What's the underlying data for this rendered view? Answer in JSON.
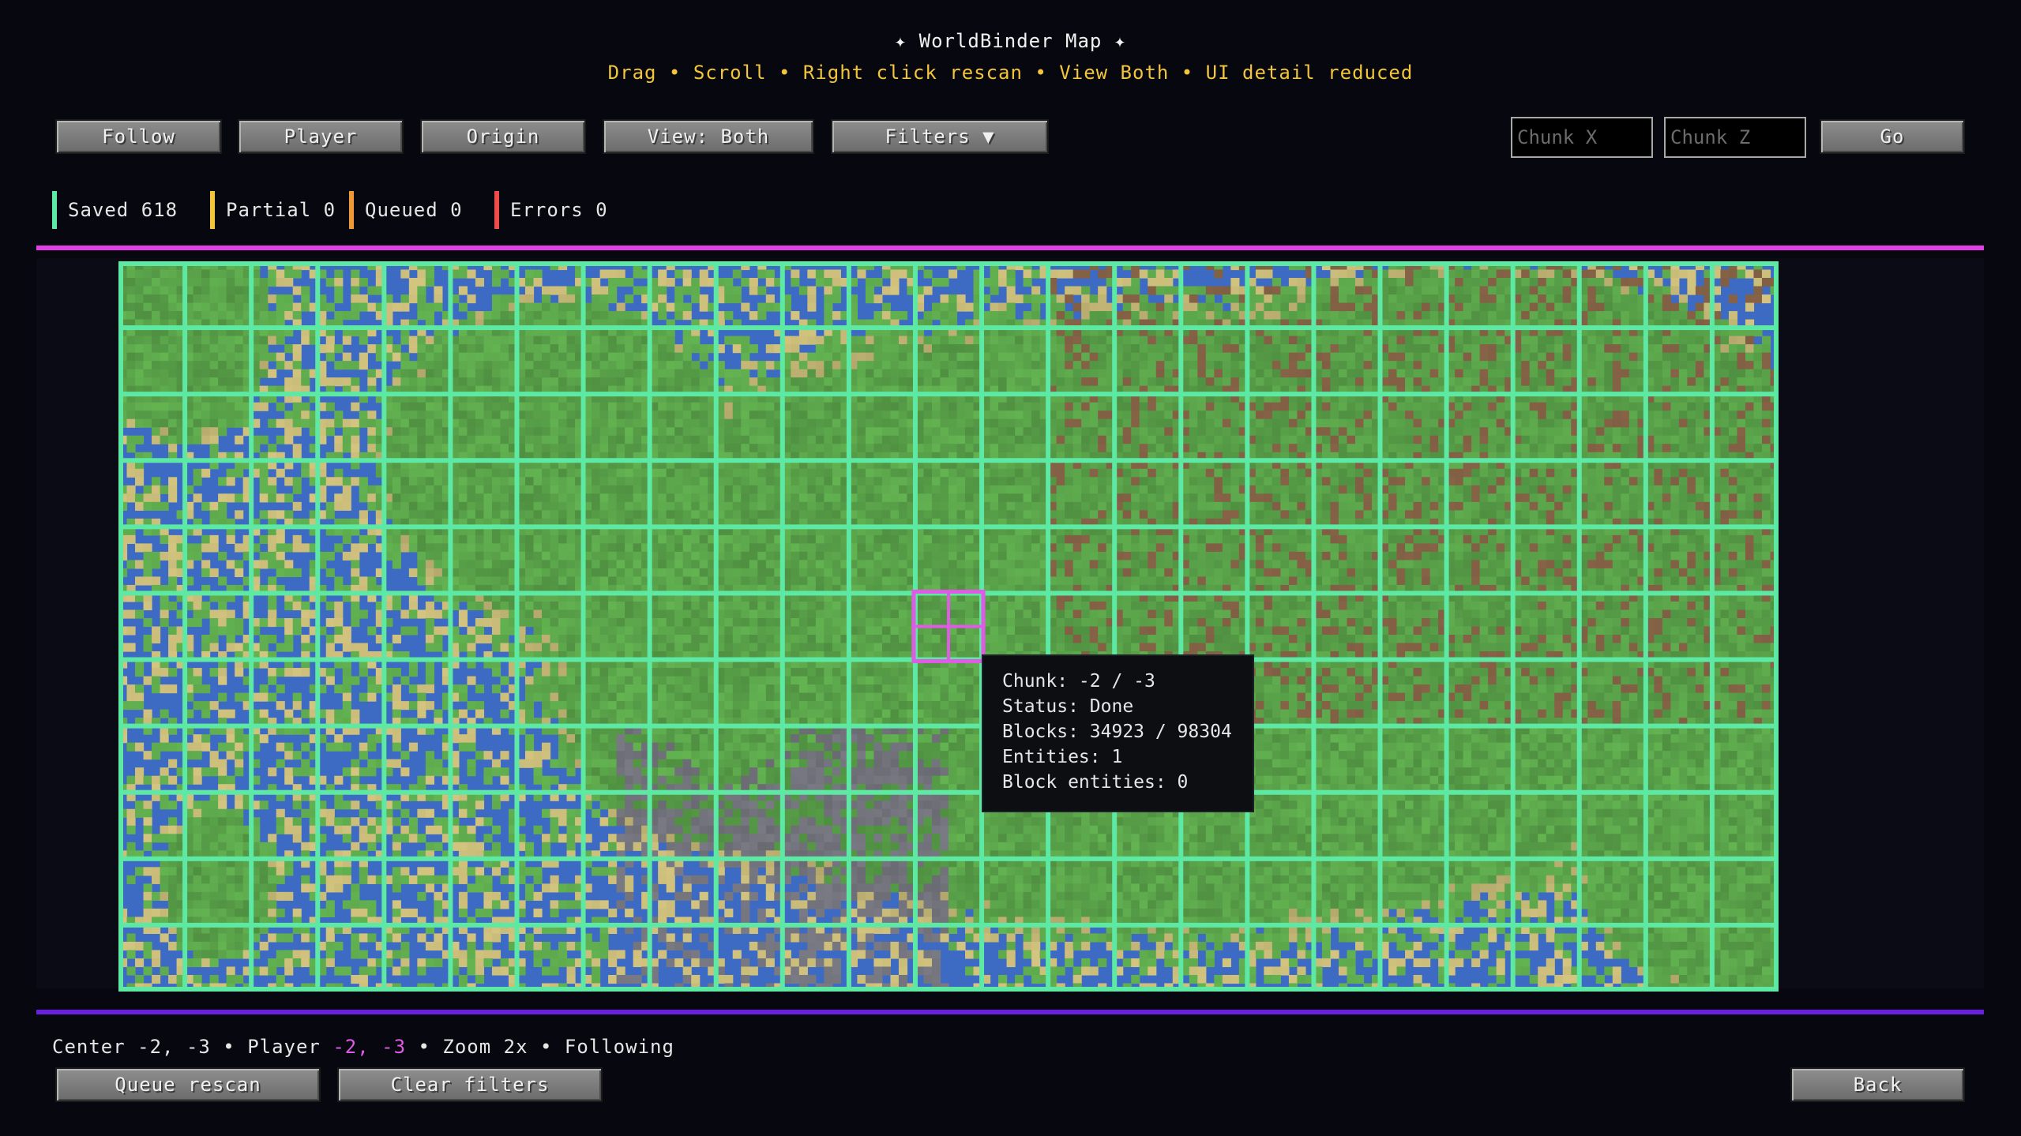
{
  "window": {
    "title": "✦ WorldBinder Map ✦",
    "subtitle": "Drag • Scroll • Right click rescan • View Both • UI detail reduced"
  },
  "toolbar": {
    "follow": "Follow",
    "player": "Player",
    "origin": "Origin",
    "view": "View: Both",
    "filters": "Filters ▼",
    "chunk_x_placeholder": "Chunk X",
    "chunk_z_placeholder": "Chunk Z",
    "go": "Go"
  },
  "legend": [
    {
      "label": "Saved 618",
      "color": "#5de8a4"
    },
    {
      "label": "Partial 0",
      "color": "#f3c53a"
    },
    {
      "label": "Queued 0",
      "color": "#f0973a"
    },
    {
      "label": "Errors 0",
      "color": "#f04a4a"
    }
  ],
  "colors": {
    "top_divider": "#e33ee8",
    "bottom_divider": "#6a1fe0",
    "grid_line": "#5de8a4",
    "selected_chunk": "#e05ae6",
    "water": "#3d6bc4",
    "grass": "#5aa34a",
    "stone": "#6f6f78",
    "sand": "#cbbd7a",
    "dirt": "#7a5a40"
  },
  "map": {
    "columns": 25,
    "rows": 11,
    "selected": {
      "col": 12,
      "row": 5
    }
  },
  "tooltip": {
    "chunk": "Chunk: -2 / -3",
    "status": "Status: Done",
    "blocks": "Blocks: 34923 / 98304",
    "entities": "Entities: 1",
    "block_entities": "Block entities: 0"
  },
  "status": {
    "center": "Center -2, -3 • Player ",
    "player_coords": "-2, -3",
    "rest": " • Zoom 2x • Following"
  },
  "actions": {
    "queue_rescan": "Queue rescan",
    "clear_filters": "Clear filters",
    "back": "Back"
  }
}
